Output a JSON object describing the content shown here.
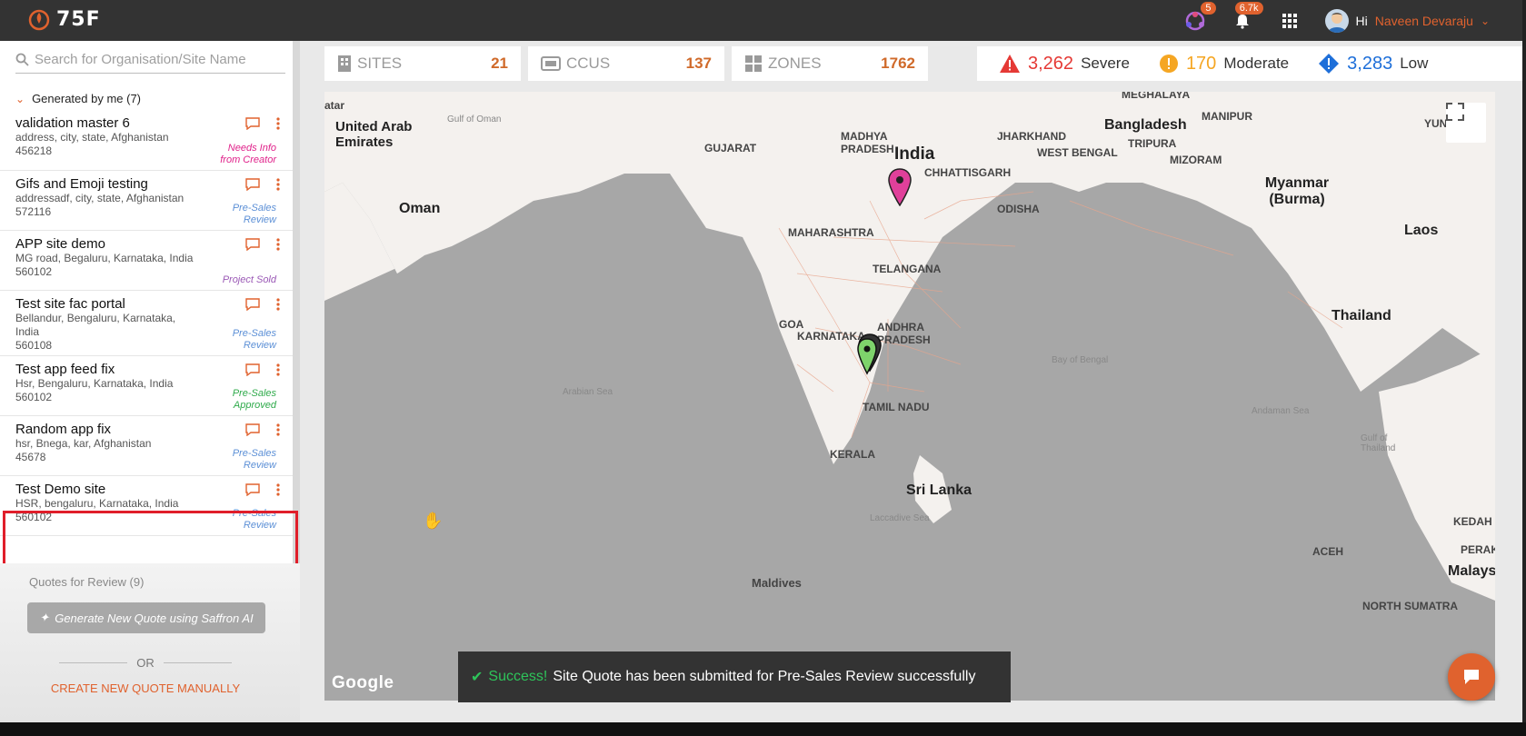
{
  "app": {
    "logo_text": "75F"
  },
  "topbar": {
    "notifications_badge_1": "5",
    "notifications_badge_2": "6.7k",
    "greeting": "Hi",
    "user_name": "Naveen Devaraju"
  },
  "sidebar": {
    "search_placeholder": "Search for Organisation/Site Name",
    "group_label": "Generated by me (7)",
    "items": [
      {
        "title": "validation master 6",
        "address": "address, city, state, Afghanistan",
        "zip": "456218",
        "status": "Needs Info from Creator",
        "status_color": "pink"
      },
      {
        "title": "Gifs and Emoji testing",
        "address": "addressadf, city, state, Afghanistan",
        "zip": "572116",
        "status": "Pre-Sales Review",
        "status_color": "blue"
      },
      {
        "title": "APP site demo",
        "address": "MG road, Begaluru, Karnataka, India",
        "zip": "560102",
        "status": "Project Sold",
        "status_color": "purple"
      },
      {
        "title": "Test site fac portal",
        "address": "Bellandur, Bengaluru, Karnataka, India",
        "zip": "560108",
        "status": "Pre-Sales Review",
        "status_color": "blue"
      },
      {
        "title": "Test app feed fix",
        "address": "Hsr, Bengaluru, Karnataka, India",
        "zip": "560102",
        "status": "Pre-Sales Approved",
        "status_color": "green"
      },
      {
        "title": "Random app fix",
        "address": "hsr, Bnega, kar, Afghanistan",
        "zip": "45678",
        "status": "Pre-Sales Review",
        "status_color": "blue"
      },
      {
        "title": "Test Demo site",
        "address": "HSR, bengaluru, Karnataka, India",
        "zip": "560102",
        "status": "Pre-Sales Review",
        "status_color": "blue"
      }
    ],
    "quotes_review_label": "Quotes for Review (9)",
    "generate_button": "Generate New Quote using Saffron AI",
    "or_label": "OR",
    "manual_link": "CREATE NEW QUOTE MANUALLY"
  },
  "stats": {
    "sites_label": "SITES",
    "sites_value": "21",
    "ccus_label": "CCUS",
    "ccus_value": "137",
    "zones_label": "ZONES",
    "zones_value": "1762"
  },
  "alerts": {
    "severe_value": "3,262",
    "severe_label": "Severe",
    "severe_color": "#e53935",
    "moderate_value": "170",
    "moderate_label": "Moderate",
    "moderate_color": "#f5a623",
    "low_value": "3,283",
    "low_label": "Low",
    "low_color": "#1e6fd9"
  },
  "map": {
    "labels": {
      "qatar": "atar",
      "uae": "United Arab Emirates",
      "oman": "Oman",
      "gulf_oman": "Gulf of Oman",
      "gujarat": "GUJARAT",
      "madhya": "MADHYA PRADESH",
      "india": "India",
      "jharkhand": "JHARKHAND",
      "west_bengal": "WEST BENGAL",
      "chhattisgarh": "CHHATTISGARH",
      "bangladesh": "Bangladesh",
      "tripura": "TRIPURA",
      "mizoram": "MIZORAM",
      "manipur": "MANIPUR",
      "meghalaya": "MEGHALAYA",
      "myanmar": "Myanmar (Burma)",
      "laos": "Laos",
      "thailand": "Thailand",
      "yun": "YUN",
      "maharashtra": "MAHARASHTRA",
      "odisha": "ODISHA",
      "telangana": "TELANGANA",
      "goa": "GOA",
      "karnataka": "KARNATAKA",
      "andhra": "ANDHRA PRADESH",
      "tamil": "TAMIL NADU",
      "kerala": "KERALA",
      "sri_lanka": "Sri Lanka",
      "arabian_sea": "Arabian Sea",
      "bay_bengal": "Bay of Bengal",
      "andaman_sea": "Andaman Sea",
      "gulf_thailand": "Gulf of Thailand",
      "laccadive": "Laccadive Sea",
      "maldives": "Maldives",
      "kedah": "KEDAH",
      "perak": "PERAK",
      "aceh": "ACEH",
      "malaysia": "Malaysia",
      "north_sumatra": "NORTH SUMATRA"
    },
    "attribution": "Google"
  },
  "toast": {
    "title": "Success!",
    "message": "Site Quote has been submitted for Pre-Sales Review successfully"
  }
}
